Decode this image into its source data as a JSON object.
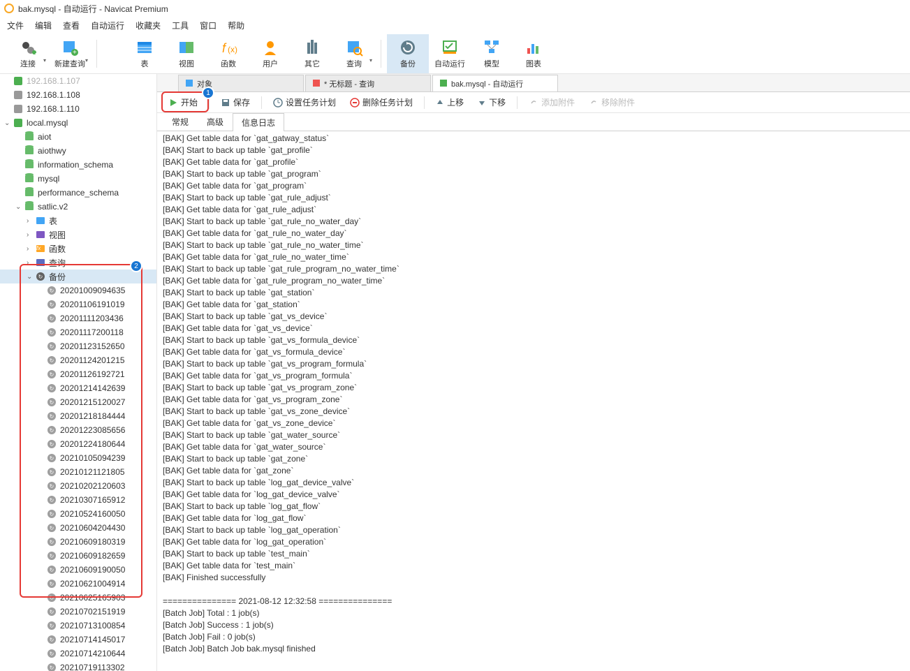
{
  "window_title": "bak.mysql - 自动运行 - Navicat Premium",
  "menu": [
    "文件",
    "编辑",
    "查看",
    "自动运行",
    "收藏夹",
    "工具",
    "窗口",
    "帮助"
  ],
  "toolbar": [
    {
      "label": "连接",
      "name": "connect"
    },
    {
      "label": "新建查询",
      "name": "new-query"
    },
    {
      "label": "表",
      "name": "tables"
    },
    {
      "label": "视图",
      "name": "views"
    },
    {
      "label": "函数",
      "name": "functions"
    },
    {
      "label": "用户",
      "name": "users"
    },
    {
      "label": "其它",
      "name": "others"
    },
    {
      "label": "查询",
      "name": "queries"
    },
    {
      "label": "备份",
      "name": "backup",
      "active": true
    },
    {
      "label": "自动运行",
      "name": "automation"
    },
    {
      "label": "模型",
      "name": "model"
    },
    {
      "label": "图表",
      "name": "charts"
    }
  ],
  "sidebar": {
    "connections": [
      {
        "name": "192.168.1.107",
        "on": true,
        "cut": true
      },
      {
        "name": "192.168.1.108",
        "on": false
      },
      {
        "name": "192.168.1.110",
        "on": false
      }
    ],
    "local": {
      "name": "local.mysql",
      "databases": [
        "aiot",
        "aiothwy",
        "information_schema",
        "mysql",
        "performance_schema"
      ],
      "expanded_db": {
        "name": "satlic.v2",
        "categories": [
          {
            "label": "表",
            "type": "table"
          },
          {
            "label": "视图",
            "type": "view"
          },
          {
            "label": "函数",
            "type": "fn"
          },
          {
            "label": "查询",
            "type": "query"
          },
          {
            "label": "备份",
            "type": "backup",
            "selected": true
          }
        ]
      }
    },
    "backups": [
      "20201009094635",
      "20201106191019",
      "20201111203436",
      "20201117200118",
      "20201123152650",
      "20201124201215",
      "20201126192721",
      "20201214142639",
      "20201215120027",
      "20201218184444",
      "20201223085656",
      "20201224180644",
      "20210105094239",
      "20210121121805",
      "20210202120603",
      "20210307165912",
      "20210524160050",
      "20210604204430",
      "20210609180319",
      "20210609182659",
      "20210609190050",
      "20210621004914",
      "20210625165903",
      "20210702151919",
      "20210713100854",
      "20210714145017",
      "20210714210644",
      "20210719113302"
    ]
  },
  "tabs": [
    {
      "label": "对象",
      "name": "objects"
    },
    {
      "label": "* 无标题 - 查询",
      "name": "untitled-query"
    },
    {
      "label": "bak.mysql - 自动运行",
      "name": "bak-mysql-auto",
      "active": true
    }
  ],
  "actions": {
    "start": "开始",
    "save": "保存",
    "set_schedule": "设置任务计划",
    "delete_schedule": "删除任务计划",
    "move_up": "上移",
    "move_down": "下移",
    "add_attachment": "添加附件",
    "remove_attachment": "移除附件"
  },
  "sub_tabs": [
    "常规",
    "高级",
    "信息日志"
  ],
  "active_sub_tab": 2,
  "log": [
    "[BAK] Get table data for `gat_gatway_status`",
    "[BAK] Start to back up table `gat_profile`",
    "[BAK] Get table data for `gat_profile`",
    "[BAK] Start to back up table `gat_program`",
    "[BAK] Get table data for `gat_program`",
    "[BAK] Start to back up table `gat_rule_adjust`",
    "[BAK] Get table data for `gat_rule_adjust`",
    "[BAK] Start to back up table `gat_rule_no_water_day`",
    "[BAK] Get table data for `gat_rule_no_water_day`",
    "[BAK] Start to back up table `gat_rule_no_water_time`",
    "[BAK] Get table data for `gat_rule_no_water_time`",
    "[BAK] Start to back up table `gat_rule_program_no_water_time`",
    "[BAK] Get table data for `gat_rule_program_no_water_time`",
    "[BAK] Start to back up table `gat_station`",
    "[BAK] Get table data for `gat_station`",
    "[BAK] Start to back up table `gat_vs_device`",
    "[BAK] Get table data for `gat_vs_device`",
    "[BAK] Start to back up table `gat_vs_formula_device`",
    "[BAK] Get table data for `gat_vs_formula_device`",
    "[BAK] Start to back up table `gat_vs_program_formula`",
    "[BAK] Get table data for `gat_vs_program_formula`",
    "[BAK] Start to back up table `gat_vs_program_zone`",
    "[BAK] Get table data for `gat_vs_program_zone`",
    "[BAK] Start to back up table `gat_vs_zone_device`",
    "[BAK] Get table data for `gat_vs_zone_device`",
    "[BAK] Start to back up table `gat_water_source`",
    "[BAK] Get table data for `gat_water_source`",
    "[BAK] Start to back up table `gat_zone`",
    "[BAK] Get table data for `gat_zone`",
    "[BAK] Start to back up table `log_gat_device_valve`",
    "[BAK] Get table data for `log_gat_device_valve`",
    "[BAK] Start to back up table `log_gat_flow`",
    "[BAK] Get table data for `log_gat_flow`",
    "[BAK] Start to back up table `log_gat_operation`",
    "[BAK] Get table data for `log_gat_operation`",
    "[BAK] Start to back up table `test_main`",
    "[BAK] Get table data for `test_main`",
    "[BAK] Finished successfully",
    "",
    "=============== 2021-08-12 12:32:58 ===============",
    "[Batch Job] Total : 1 job(s)",
    "[Batch Job] Success : 1 job(s)",
    "[Batch Job] Fail : 0 job(s)",
    "[Batch Job] Batch Job bak.mysql finished"
  ]
}
